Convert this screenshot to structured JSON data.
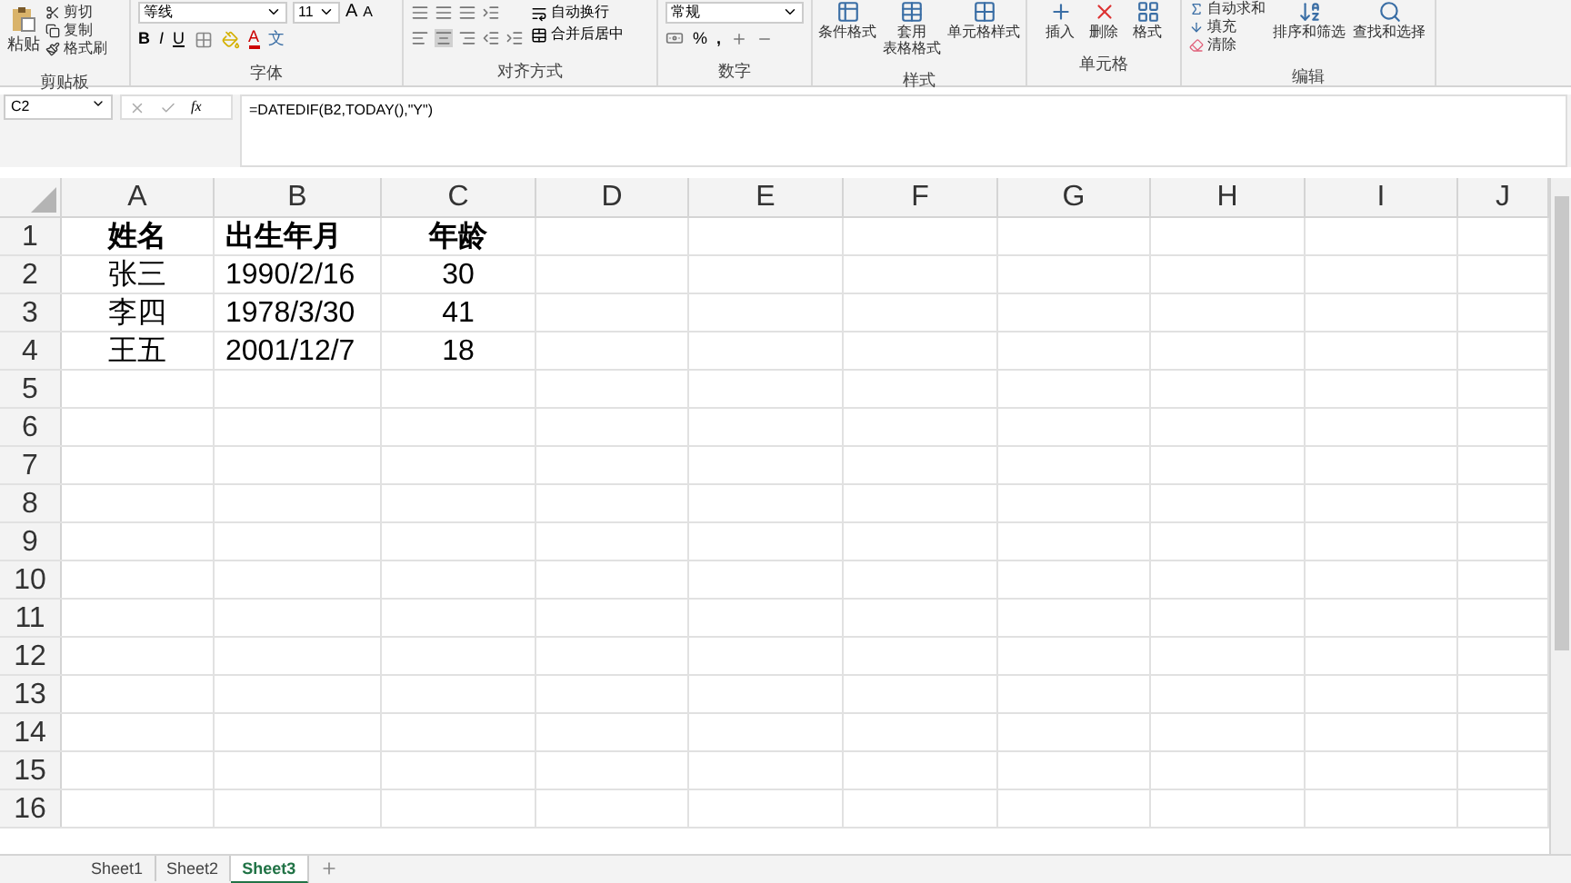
{
  "ribbon": {
    "clipboard": {
      "label": "剪贴板",
      "paste": "粘贴",
      "small": [
        "剪切",
        "复制",
        "格式刷"
      ]
    },
    "font": {
      "label": "字体",
      "font_name": "等线",
      "font_size": "11",
      "grow": "A",
      "shrink": "A",
      "bold": "B",
      "italic": "I",
      "underline": "U",
      "font_color": "A",
      "phonetic": "文"
    },
    "alignment": {
      "label": "对齐方式",
      "wrap": "自动换行",
      "merge": "合并后居中"
    },
    "number": {
      "label": "数字",
      "format": "常规",
      "percent": "%",
      "comma": ","
    },
    "styles": {
      "label": "样式",
      "buttons": [
        {
          "lines": [
            "条件格式"
          ]
        },
        {
          "lines": [
            "套用",
            "表格格式"
          ]
        },
        {
          "lines": [
            "单元格样式"
          ]
        }
      ]
    },
    "cells": {
      "label": "单元格",
      "buttons": [
        "插入",
        "删除",
        "格式"
      ]
    },
    "editing": {
      "label": "编辑",
      "small": [
        "自动求和",
        "填充",
        "清除"
      ],
      "large": [
        "排序和筛选",
        "查找和选择"
      ]
    }
  },
  "formula_bar": {
    "name_box": "C2",
    "fx": "fx",
    "formula": "=DATEDIF(B2,TODAY(),\"Y\")"
  },
  "grid": {
    "columns": [
      "A",
      "B",
      "C",
      "D",
      "E",
      "F",
      "G",
      "H",
      "I",
      "J"
    ],
    "rows": [
      {
        "number": "1",
        "bold": true,
        "cells": [
          "姓名",
          "出生年月",
          "年龄"
        ]
      },
      {
        "number": "2",
        "bold": false,
        "cells": [
          "张三",
          "1990/2/16",
          "30"
        ]
      },
      {
        "number": "3",
        "bold": false,
        "cells": [
          "李四",
          "1978/3/30",
          "41"
        ]
      },
      {
        "number": "4",
        "bold": false,
        "cells": [
          "王五",
          "2001/12/7",
          "18"
        ]
      },
      {
        "number": "5"
      },
      {
        "number": "6"
      },
      {
        "number": "7"
      },
      {
        "number": "8"
      },
      {
        "number": "9"
      },
      {
        "number": "10"
      },
      {
        "number": "11"
      },
      {
        "number": "12"
      },
      {
        "number": "13"
      },
      {
        "number": "14"
      },
      {
        "number": "15"
      },
      {
        "number": "16"
      }
    ]
  },
  "sheet_tabs": [
    {
      "label": "Sheet1",
      "selected": false
    },
    {
      "label": "Sheet2",
      "selected": false
    },
    {
      "label": "Sheet3",
      "selected": true
    }
  ]
}
